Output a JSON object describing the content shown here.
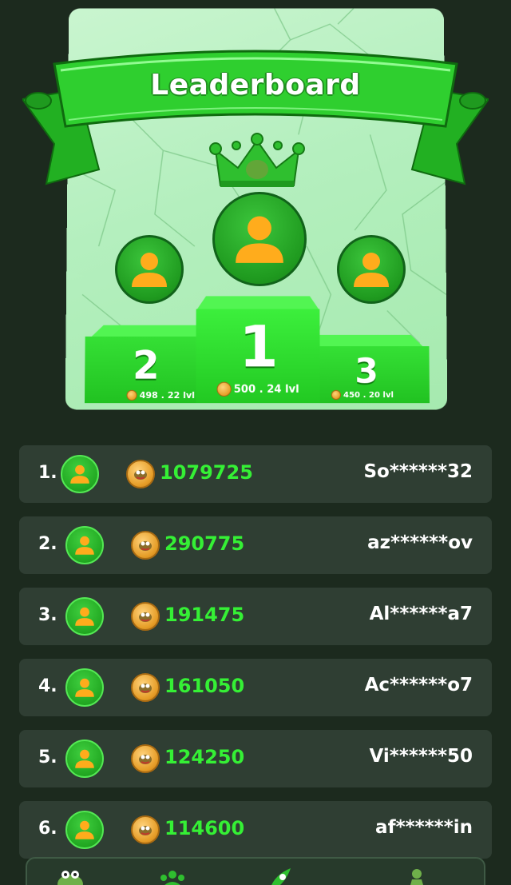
{
  "header": {
    "title": "Leaderboard"
  },
  "podium": {
    "first": {
      "place": "1",
      "coins": "500",
      "level": "24 lvl"
    },
    "second": {
      "place": "2",
      "coins": "498",
      "level": "22 lvl"
    },
    "third": {
      "place": "3",
      "coins": "450",
      "level": "20 lvl"
    }
  },
  "leaderboard": {
    "rows": [
      {
        "rank": "1.",
        "score": "1079725",
        "name": "So******32"
      },
      {
        "rank": "2.",
        "score": "290775",
        "name": "az******ov"
      },
      {
        "rank": "3.",
        "score": "191475",
        "name": "Al******a7"
      },
      {
        "rank": "4.",
        "score": "161050",
        "name": "Ac******o7"
      },
      {
        "rank": "5.",
        "score": "124250",
        "name": "Vi******50"
      },
      {
        "rank": "6.",
        "score": "114600",
        "name": "af******in"
      }
    ]
  },
  "nav": {
    "items": [
      {
        "icon": "frog-icon"
      },
      {
        "icon": "friends-icon"
      },
      {
        "icon": "rocket-icon"
      },
      {
        "icon": "profile-icon"
      }
    ]
  },
  "colors": {
    "background": "#1c2a1e",
    "row": "#2f3e33",
    "accent_green": "#35f035",
    "podium_green": "#21c221",
    "coin_gold": "#e59c26"
  }
}
